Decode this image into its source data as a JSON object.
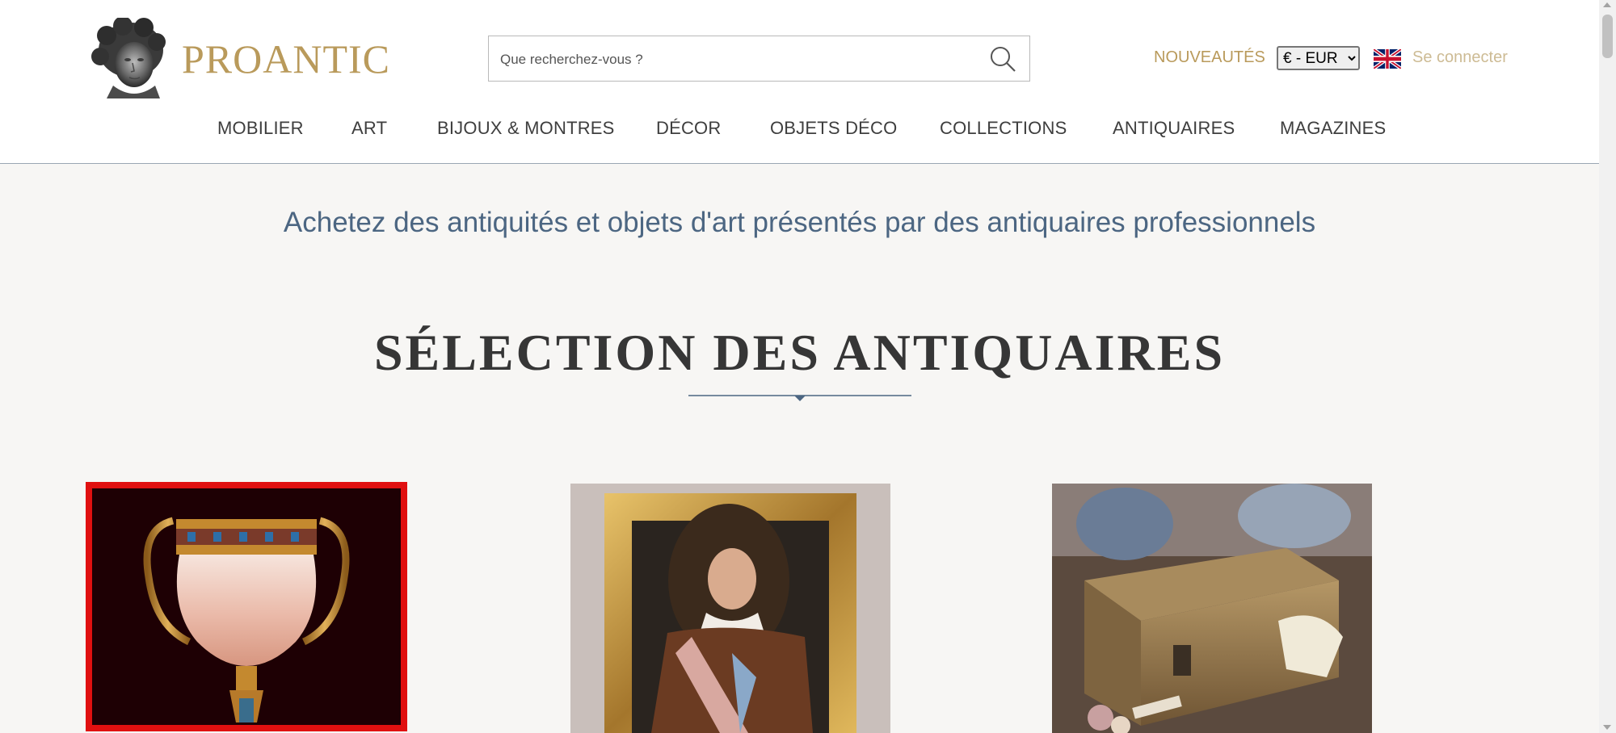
{
  "brand": {
    "name": "PROANTIC",
    "color": "#b99a5b"
  },
  "search": {
    "placeholder": "Que recherchez-vous ?"
  },
  "topbar": {
    "new_label": "NOUVEAUTÉS",
    "currency_options": [
      "€ - EUR"
    ],
    "currency_selected": "€ - EUR",
    "login_label": "Se connecter"
  },
  "menu": {
    "items": [
      {
        "label": "MOBILIER"
      },
      {
        "label": "ART"
      },
      {
        "label": "BIJOUX & MONTRES"
      },
      {
        "label": "DÉCOR"
      },
      {
        "label": "OBJETS DÉCO"
      },
      {
        "label": "COLLECTIONS"
      },
      {
        "label": "ANTIQUAIRES"
      },
      {
        "label": "MAGAZINES"
      }
    ]
  },
  "hero": {
    "tagline": "Achetez des antiquités et objets d'art présentés par des antiquaires professionnels",
    "section_title": "SÉLECTION DES ANTIQUAIRES"
  },
  "products": [
    {
      "image": "gilt-onyx-cup-image",
      "selected": true
    },
    {
      "image": "framed-portrait-image",
      "selected": false
    },
    {
      "image": "brass-casket-image",
      "selected": false
    }
  ],
  "colors": {
    "accent": "#b99a5b",
    "tagline": "#4c6682",
    "selection_border": "#e01010",
    "page_bg": "#f7f6f4"
  }
}
